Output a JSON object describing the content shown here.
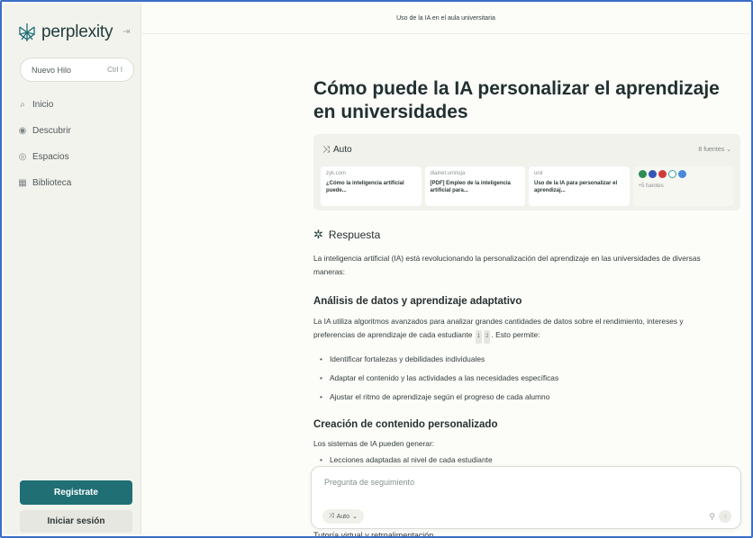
{
  "brand": {
    "name": "perplexity",
    "collapse_icon": "sidebar-collapse-icon"
  },
  "sidebar": {
    "new_thread": {
      "label": "Nuevo Hilo",
      "shortcut": "Ctrl I"
    },
    "items": [
      {
        "label": "Inicio",
        "icon": "search-icon"
      },
      {
        "label": "Descubrir",
        "icon": "compass-icon"
      },
      {
        "label": "Espacios",
        "icon": "spaces-icon"
      },
      {
        "label": "Biblioteca",
        "icon": "library-icon"
      }
    ],
    "register_label": "Registrate",
    "login_label": "Iniciar sesión"
  },
  "header": {
    "thread_title": "Uso de la IA en el aula universitaria"
  },
  "main": {
    "title": "Cómo puede la IA personalizar el aprendizaje en universidades",
    "sources": {
      "mode_label": "Auto",
      "count_label": "8 fuentes",
      "items": [
        {
          "domain": "zyk.com",
          "title": "¿Cómo la inteligencia artificial puede..."
        },
        {
          "domain": "dialnet.unirioja",
          "title": "[PDF] Empleo de la inteligencia artificial para..."
        },
        {
          "domain": "unir",
          "title": "Uso de la IA para personalizar el aprendizaj..."
        }
      ],
      "more_label": "+5 fuentes"
    },
    "answer_label": "Respuesta",
    "intro": "La inteligencia artificial (IA) está revolucionando la personalización del aprendizaje en las universidades de diversas maneras:",
    "section1": {
      "heading": "Análisis de datos y aprendizaje adaptativo",
      "para": "La IA utiliza algoritmos avanzados para analizar grandes cantidades de datos sobre el rendimiento, intereses y preferencias de aprendizaje de cada estudiante",
      "cite1": "1",
      "cite2": "2",
      "para_end": ". Esto permite:",
      "bullets": [
        "Identificar fortalezas y debilidades individuales",
        "Adaptar el contenido y las actividades a las necesidades específicas",
        "Ajustar el ritmo de aprendizaje según el progreso de cada alumno"
      ]
    },
    "section2": {
      "heading": "Creación de contenido personalizado",
      "para": "Los sistemas de IA pueden generar:",
      "partial_bullet": "Lecciones adaptadas al nivel de cada estudiante"
    },
    "followup": {
      "placeholder": "Pregunta de seguimiento",
      "mode_label": "Auto"
    },
    "cut_text": "Tutoría virtual y retroalimentación"
  }
}
